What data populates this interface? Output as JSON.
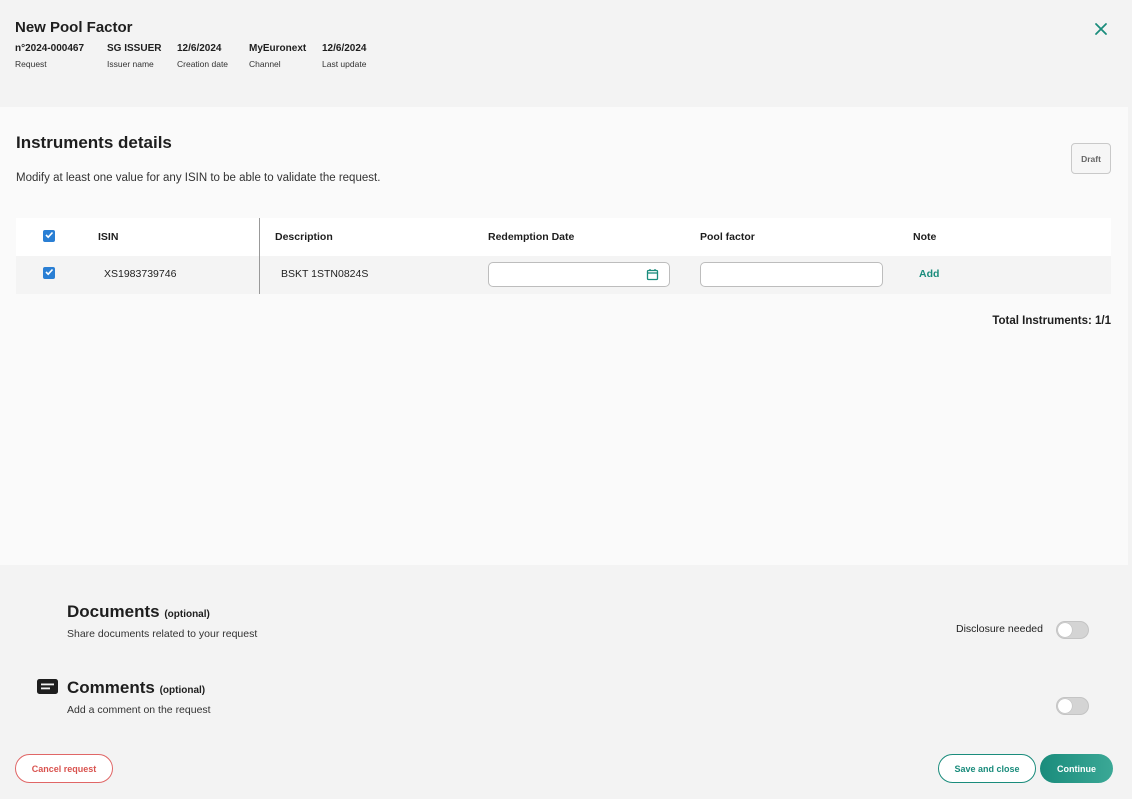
{
  "header": {
    "title": "New Pool Factor",
    "meta": [
      {
        "value": "n°2024-000467",
        "label": "Request"
      },
      {
        "value": "SG ISSUER",
        "label": "Issuer name"
      },
      {
        "value": "12/6/2024",
        "label": "Creation date"
      },
      {
        "value": "MyEuronext",
        "label": "Channel"
      },
      {
        "value": "12/6/2024",
        "label": "Last update"
      }
    ],
    "close_icon": "close-icon"
  },
  "instruments": {
    "title": "Instruments details",
    "subtitle": "Modify at least one value for any ISIN to be able to validate the request.",
    "status_badge": "Draft",
    "columns": [
      "ISIN",
      "Description",
      "Redemption Date",
      "Pool factor",
      "Note"
    ],
    "rows": [
      {
        "checked": true,
        "isin": "XS1983739746",
        "description": "BSKT 1STN0824S",
        "redemption_date": "",
        "pool_factor": "",
        "note_action": "Add"
      }
    ],
    "total": "Total Instruments: 1/1",
    "accent_color": "#1a8c7c",
    "checkbox_color": "#2a7fd4"
  },
  "documents": {
    "title": "Documents",
    "optional": "(optional)",
    "subtitle": "Share documents related to your request",
    "disclosure_label": "Disclosure needed",
    "disclosure_on": false
  },
  "comments": {
    "title": "Comments",
    "optional": "(optional)",
    "subtitle": "Add a comment on the request",
    "icon": "comment-icon",
    "toggle_on": false
  },
  "footer": {
    "cancel_label": "Cancel request",
    "save_label": "Save and close",
    "continue_label": "Continue"
  }
}
